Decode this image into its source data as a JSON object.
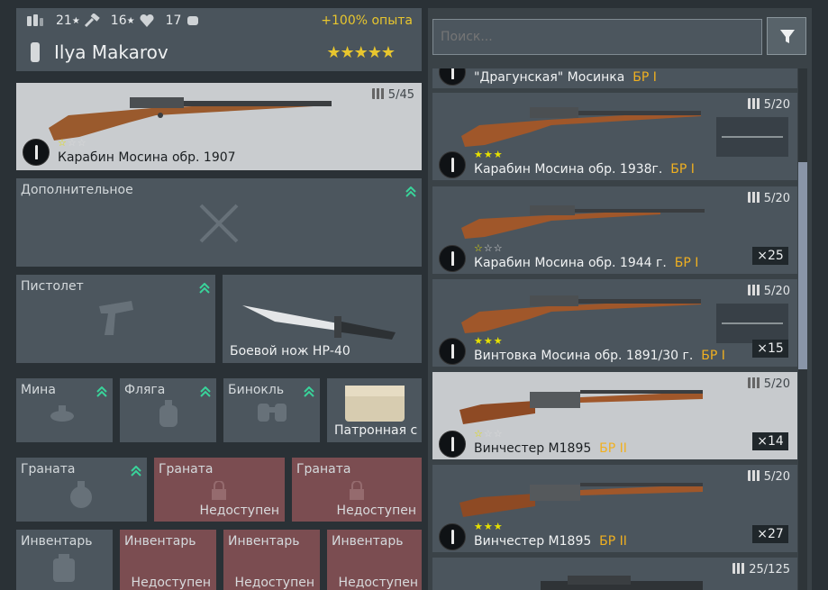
{
  "header": {
    "stats": [
      {
        "icon": "ammo-icon",
        "value": "21"
      },
      {
        "icon": "hammer-icon",
        "value": "16"
      },
      {
        "icon": "heart-icon",
        "value": "17"
      }
    ],
    "exp_bonus": "+100% опыта",
    "soldier_name": "Ilya Makarov",
    "rank_stars": 5,
    "colors": {
      "exp_bonus": "#e8c62e",
      "star": "#e8c62e"
    }
  },
  "primary": {
    "name": "Карабин Мосина обр. 1907",
    "ammo": "5/45",
    "stars_filled": 1,
    "stars_total": 3
  },
  "slots": {
    "additional": {
      "label": "Дополнительное"
    },
    "pistol": {
      "label": "Пистолет"
    },
    "melee": {
      "label": "Боевой нож НР-40"
    },
    "mine": {
      "label": "Мина"
    },
    "flask": {
      "label": "Фляга"
    },
    "binoculars": {
      "label": "Бинокль"
    },
    "ammo_pouch": {
      "label": "Патронная с"
    },
    "grenade1": {
      "label": "Граната"
    },
    "grenade2": {
      "label": "Граната",
      "status": "Недоступен"
    },
    "grenade3": {
      "label": "Граната",
      "status": "Недоступен"
    },
    "inventory1": {
      "label": "Инвентарь"
    },
    "inventory2": {
      "label": "Инвентарь",
      "status": "Недоступен"
    },
    "inventory3": {
      "label": "Инвентарь",
      "status": "Недоступен"
    },
    "inventory4": {
      "label": "Инвентарь",
      "status": "Недоступен"
    }
  },
  "search": {
    "placeholder": "Поиск..."
  },
  "weapon_list": [
    {
      "name": "\"Драгунская\" Мосинка",
      "br": "БР I"
    },
    {
      "name": "Карабин Мосина обр. 1938г.",
      "br": "БР I",
      "ammo": "5/20",
      "stars_filled": 3,
      "stars_total": 3
    },
    {
      "name": "Карабин Мосина обр. 1944 г.",
      "br": "БР I",
      "ammo": "5/20",
      "stars_filled": 1,
      "stars_total": 3,
      "count": "×25"
    },
    {
      "name": "Винтовка Мосина обр. 1891/30 г.",
      "br": "БР I",
      "ammo": "5/20",
      "stars_filled": 3,
      "stars_total": 3,
      "count": "×15"
    },
    {
      "name": "Винчестер M1895",
      "br": "БР II",
      "ammo": "5/20",
      "stars_filled": 1,
      "stars_total": 3,
      "count": "×14"
    },
    {
      "name": "Винчестер M1895",
      "br": "БР II",
      "ammo": "5/20",
      "stars_filled": 3,
      "stars_total": 3,
      "count": "×27"
    },
    {
      "ammo": "25/125"
    }
  ]
}
